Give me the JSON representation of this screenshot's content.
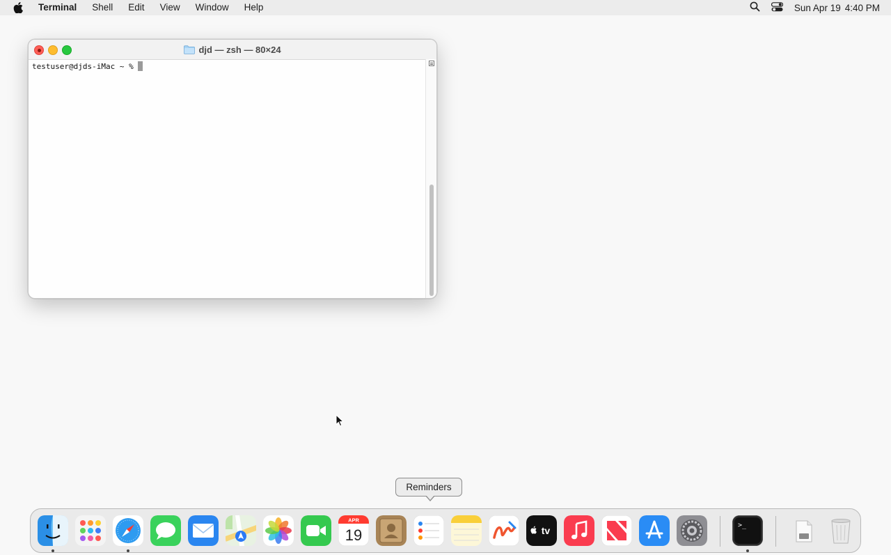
{
  "menubar": {
    "app_name": "Terminal",
    "menus": [
      "Shell",
      "Edit",
      "View",
      "Window",
      "Help"
    ],
    "date": "Sun Apr 19",
    "time": "4:40 PM"
  },
  "window": {
    "title": "djd — zsh — 80×24",
    "prompt": "testuser@djds-iMac ~ %"
  },
  "tooltip": {
    "label": "Reminders"
  },
  "dock": {
    "items": [
      {
        "name": "Finder",
        "icon": "finder-icon",
        "running": true
      },
      {
        "name": "Launchpad",
        "icon": "launchpad-icon",
        "running": false
      },
      {
        "name": "Safari",
        "icon": "safari-icon",
        "running": true
      },
      {
        "name": "Messages",
        "icon": "messages-icon",
        "running": false
      },
      {
        "name": "Mail",
        "icon": "mail-icon",
        "running": false
      },
      {
        "name": "Maps",
        "icon": "maps-icon",
        "running": false
      },
      {
        "name": "Photos",
        "icon": "photos-icon",
        "running": false
      },
      {
        "name": "FaceTime",
        "icon": "facetime-icon",
        "running": false
      },
      {
        "name": "Calendar",
        "icon": "calendar-icon",
        "running": false
      },
      {
        "name": "Contacts",
        "icon": "contacts-icon",
        "running": false
      },
      {
        "name": "Reminders",
        "icon": "reminders-icon",
        "running": false
      },
      {
        "name": "Notes",
        "icon": "notes-icon",
        "running": false
      },
      {
        "name": "Freeform",
        "icon": "freeform-icon",
        "running": false
      },
      {
        "name": "TV",
        "icon": "tv-icon",
        "running": false
      },
      {
        "name": "Music",
        "icon": "music-icon",
        "running": false
      },
      {
        "name": "News",
        "icon": "news-icon",
        "running": false
      },
      {
        "name": "App Store",
        "icon": "app-store-icon",
        "running": false
      },
      {
        "name": "System Settings",
        "icon": "system-settings-icon",
        "running": false
      },
      {
        "name": "Terminal",
        "icon": "terminal-icon",
        "running": true
      },
      {
        "name": "Downloads",
        "icon": "downloads-stack-icon",
        "running": false
      },
      {
        "name": "Trash",
        "icon": "trash-icon",
        "running": false
      }
    ],
    "calendar": {
      "month": "APR",
      "day": "19"
    },
    "tv_label": "tv"
  },
  "colors": {
    "close": "#fe5f57",
    "minimize": "#febc2e",
    "maximize": "#28c840"
  }
}
